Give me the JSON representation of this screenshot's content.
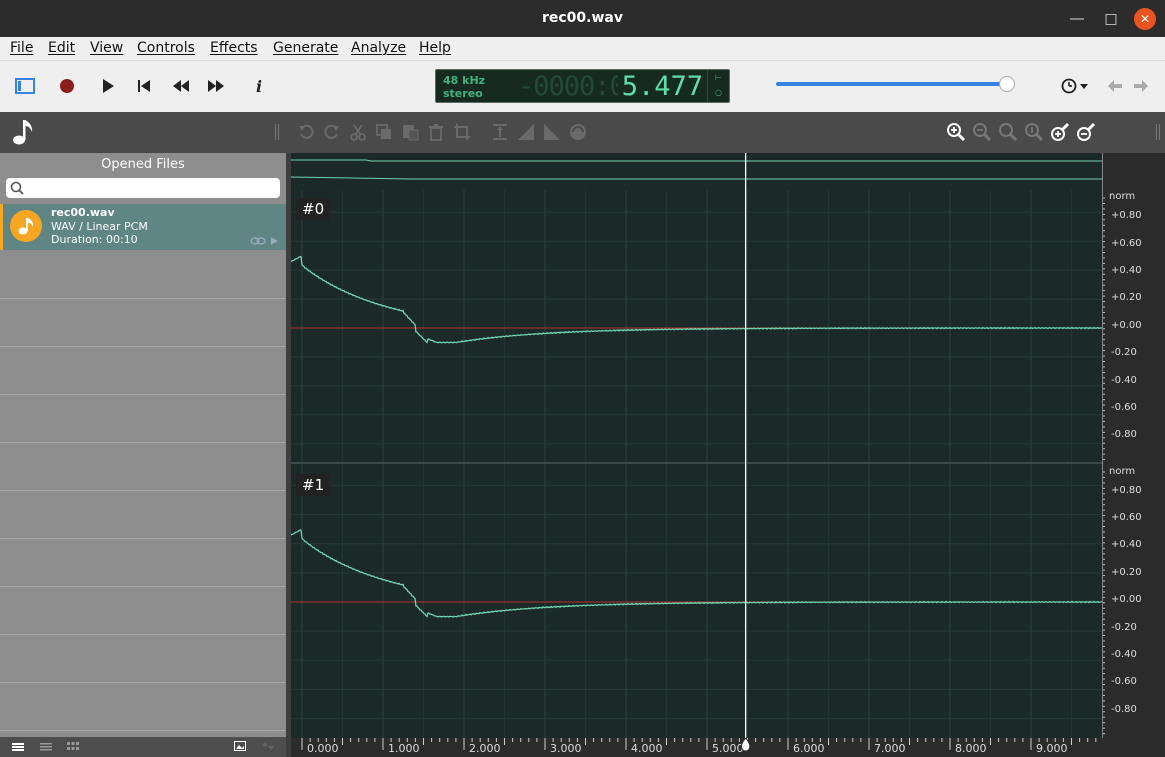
{
  "window": {
    "title": "rec00.wav"
  },
  "menu": [
    "File",
    "Edit",
    "View",
    "Controls",
    "Effects",
    "Generate",
    "Analyze",
    "Help"
  ],
  "toolbar": {
    "icons": [
      "sidebar-toggle-icon",
      "record-icon",
      "play-icon",
      "skip-start-icon",
      "rewind-icon",
      "fast-forward-icon",
      "info-icon"
    ],
    "info_label": "i",
    "colors": {
      "accent": "#3584e4",
      "record": "#8b1d1d"
    }
  },
  "display": {
    "sample_rate": "48 kHz",
    "channels": "stereo",
    "dim_digits": "-0000:00:0",
    "position": "5.477",
    "side_top": "⊢",
    "side_bottom": "○"
  },
  "playback_slider": {
    "value": 0.98
  },
  "edit_icons": [
    "undo-icon",
    "redo-icon",
    "cut-icon",
    "copy-icon",
    "paste-icon",
    "delete-icon",
    "crop-icon",
    "normalize-icon",
    "fade-in-icon",
    "fade-out-icon",
    "resample-icon"
  ],
  "zoom_icons": [
    "zoom-in-icon",
    "zoom-out-icon",
    "zoom-selection-icon",
    "zoom-fit-icon",
    "zoom-in-vertical-icon",
    "zoom-out-vertical-icon"
  ],
  "sidebar": {
    "title": "Opened Files",
    "search_placeholder": "",
    "files": [
      {
        "name": "rec00.wav",
        "format": "WAV / Linear PCM",
        "duration": "Duration: 00:10"
      }
    ]
  },
  "tracks": [
    {
      "label": "#0",
      "scale_title": "norm"
    },
    {
      "label": "#1",
      "scale_title": "norm"
    }
  ],
  "scale_ticks": [
    "+0.80",
    "+0.60",
    "+0.40",
    "+0.20",
    "+0.00",
    "-0.20",
    "-0.40",
    "-0.60",
    "-0.80"
  ],
  "timeline": {
    "labels": [
      "0.000",
      "1.000",
      "2.000",
      "3.000",
      "4.000",
      "5.000",
      "6.000",
      "7.000",
      "8.000",
      "9.000"
    ],
    "duration_seconds": 10,
    "cursor_seconds": 5.477
  },
  "colors": {
    "wave": "#6fd4b0",
    "zero_line": "#b03030",
    "background": "#1b2a28"
  }
}
